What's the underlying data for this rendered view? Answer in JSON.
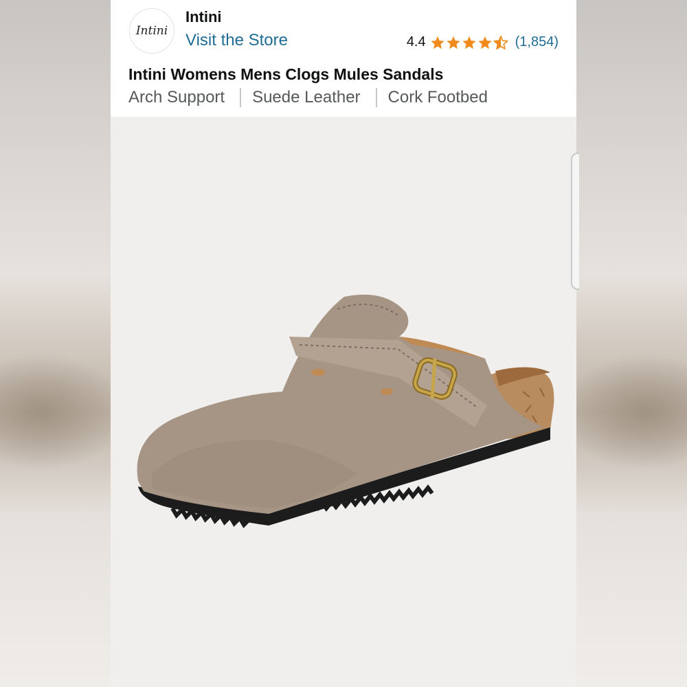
{
  "store": {
    "logo_text": "Intini",
    "brand_name": "Intini",
    "visit_link": "Visit the Store"
  },
  "rating": {
    "value": "4.4",
    "stars": 4.4,
    "count": "(1,854)",
    "star_color": "#f08a1a"
  },
  "product": {
    "title": "Intini Womens Mens Clogs Mules Sandals",
    "features": [
      "Arch Support",
      "Suede Leather",
      "Cork Footbed"
    ],
    "image_subject": "taupe-suede-clog-with-buckle-strap"
  },
  "colors": {
    "link": "#1f6c94",
    "suede": "#a69584",
    "cork": "#b98c5f",
    "sole": "#1c1c1c"
  }
}
